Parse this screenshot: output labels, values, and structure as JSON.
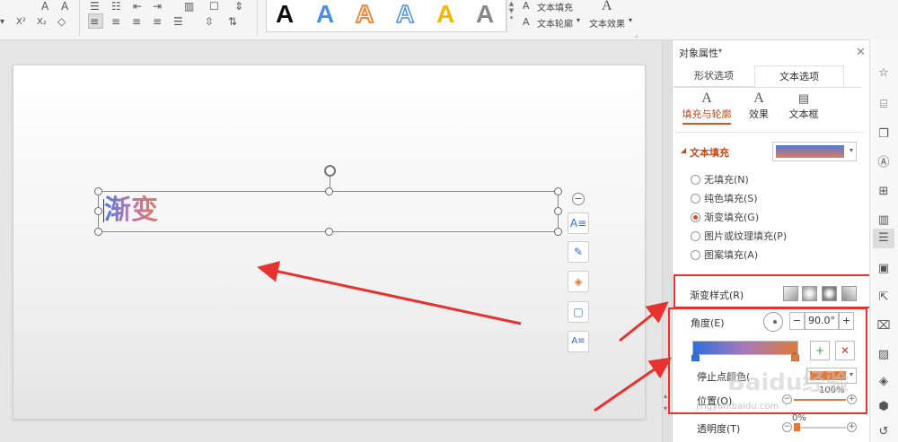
{
  "ribbon": {
    "font_a1": "A",
    "font_a2": "A",
    "superscript": "X²",
    "subscript": "X₂",
    "gallery_letters": [
      "A",
      "A",
      "A",
      "A",
      "A",
      "A"
    ],
    "gallery_colors": [
      "#111111",
      "#4a90e2",
      "#f08a3c",
      "#4a90e2",
      "#f3b800",
      "#888888"
    ],
    "text_fill": "文本填充",
    "text_outline": "文本轮廓",
    "text_effect": "文本效果"
  },
  "slide": {
    "text": "渐变"
  },
  "panel": {
    "title": "对象属性",
    "tabs": [
      "形状选项",
      "文本选项"
    ],
    "subtabs": [
      "填充与轮廓",
      "效果",
      "文本框"
    ],
    "section_title": "文本填充",
    "fill_options": [
      "无填充(N)",
      "纯色填充(S)",
      "渐变填充(G)",
      "图片或纹理填充(P)",
      "图案填充(A)"
    ],
    "selected_fill_index": 2,
    "gradient_style_label": "渐变样式(R)",
    "angle_label": "角度(E)",
    "angle_value": "90.0°",
    "stop_color_label": "停止点颜色(",
    "position_label": "位置(O)",
    "position_value": "100%",
    "transparency_label": "透明度(T)",
    "transparency_value": "0%",
    "accent": "#d2541f"
  },
  "watermark": {
    "text": "Baidu经验",
    "url": "jingyan.baidu.com"
  }
}
